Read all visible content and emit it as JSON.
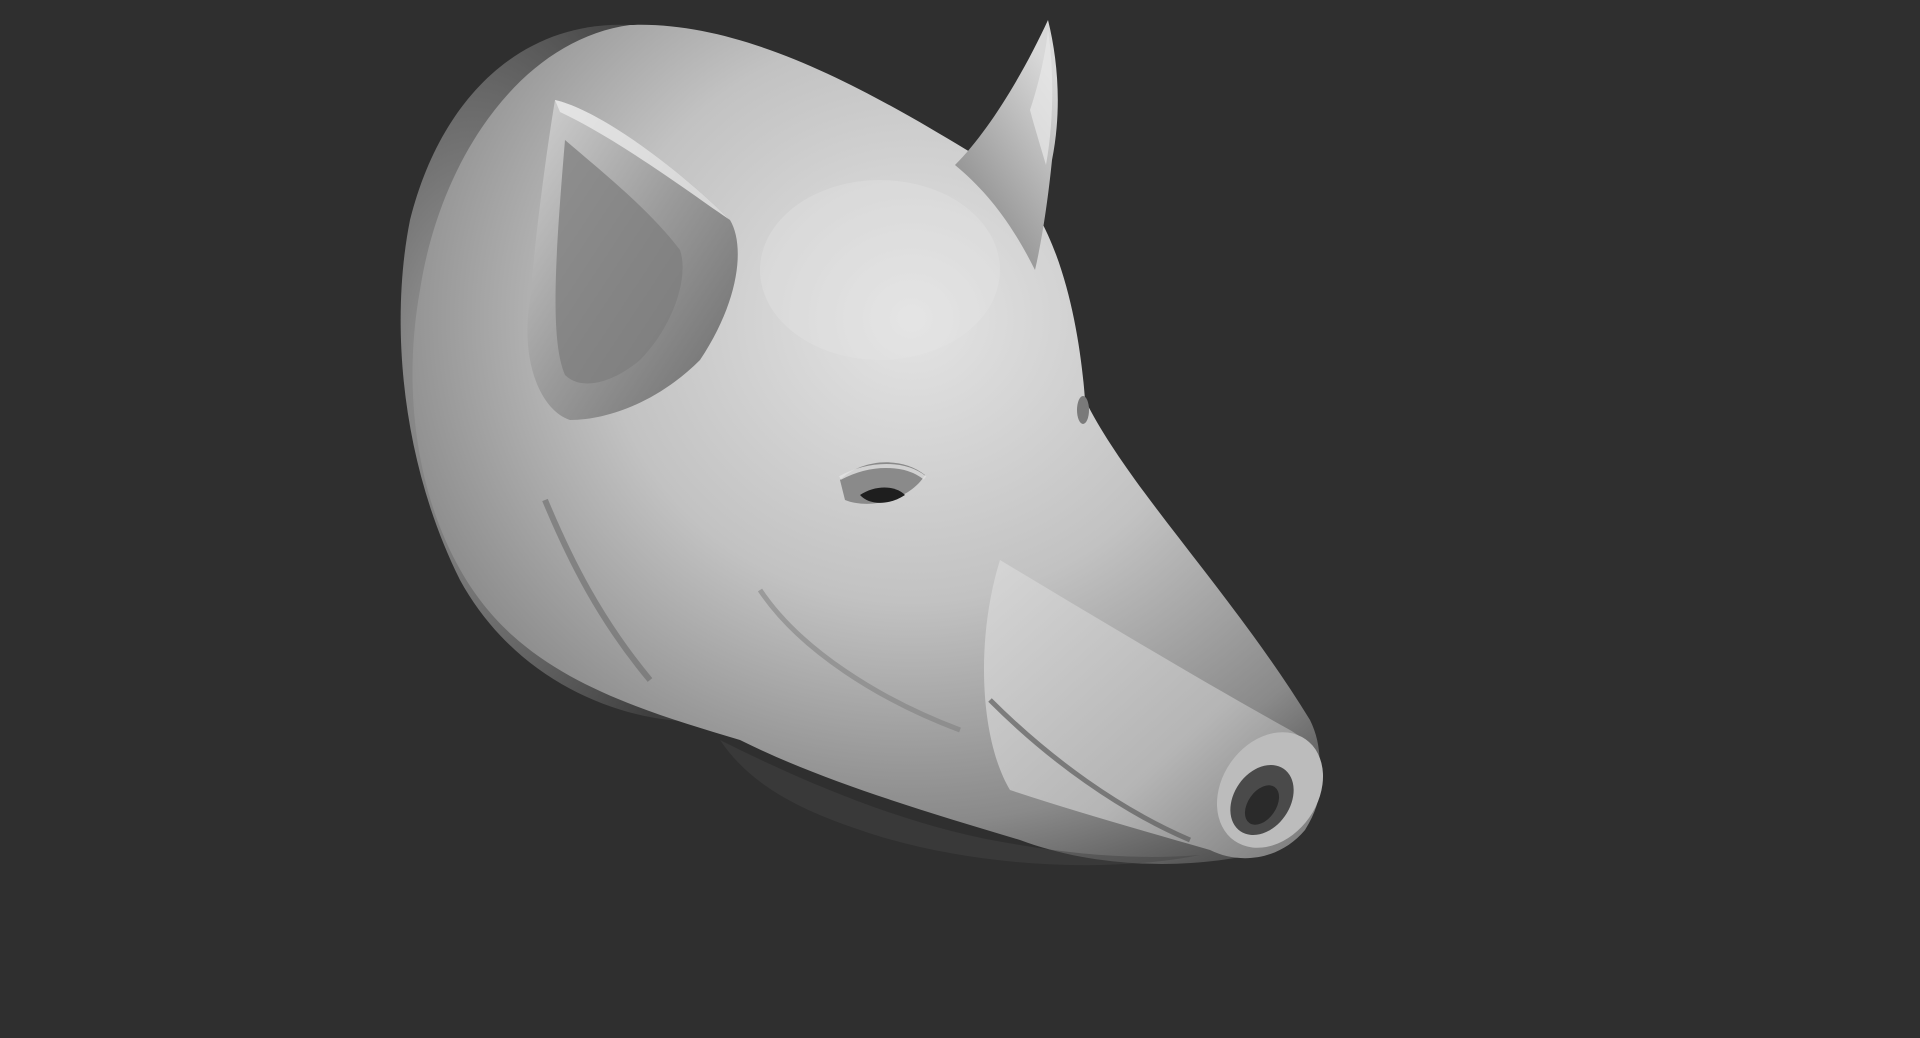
{
  "viewport": {
    "background_color": "#2f2f2f",
    "model_color": "#bdbdbd",
    "model": "pig-head-sculpt"
  }
}
